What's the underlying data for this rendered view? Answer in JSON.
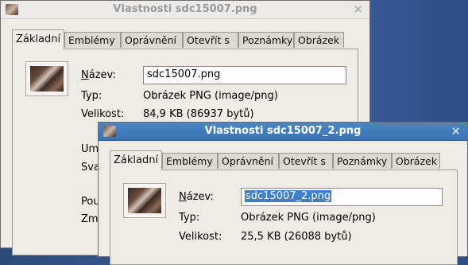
{
  "window1": {
    "title": "Vlastnosti sdc15007.png",
    "close": "✕",
    "tabs": [
      "Základní",
      "Emblémy",
      "Oprávnění",
      "Otevřít s",
      "Poznámky",
      "Obrázek"
    ],
    "name_label_u": "N",
    "name_label_rest": "ázev:",
    "name_value": "sdc15007.png",
    "type_label": "Typ:",
    "type_value": "Obrázek PNG (image/png)",
    "size_label": "Velikost:",
    "size_value": "84,9 KB (86937 bytů)",
    "partial_labels": [
      "Um",
      "Sva",
      "Pou",
      "Zm"
    ]
  },
  "window2": {
    "title": "Vlastnosti sdc15007_2.png",
    "close": "✕",
    "tabs": [
      "Základní",
      "Emblémy",
      "Oprávnění",
      "Otevřít s",
      "Poznámky",
      "Obrázek"
    ],
    "name_label_u": "N",
    "name_label_rest": "ázev:",
    "name_value": "sdc15007_2.png",
    "type_label": "Typ:",
    "type_value": "Obrázek PNG (image/png)",
    "size_label": "Velikost:",
    "size_value": "25,5 KB (26088 bytů)"
  },
  "colors": {
    "desktop": "#3c5a8a",
    "active_titlebar": "#3a73b5",
    "selection": "#3c7fcb"
  },
  "icons": [
    "image-thumbnail-icon",
    "close-icon"
  ]
}
